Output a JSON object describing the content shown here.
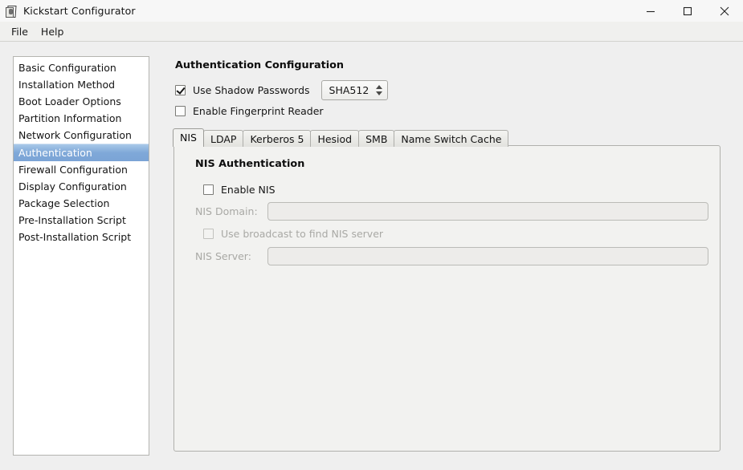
{
  "window": {
    "title": "Kickstart Configurator",
    "icon": "kickstart-app-icon",
    "controls": {
      "minimize": "minimize-icon",
      "maximize": "maximize-icon",
      "close": "close-icon"
    }
  },
  "menubar": {
    "items": [
      {
        "label": "File"
      },
      {
        "label": "Help"
      }
    ]
  },
  "sidebar": {
    "items": [
      {
        "label": "Basic Configuration",
        "selected": false
      },
      {
        "label": "Installation Method",
        "selected": false
      },
      {
        "label": "Boot Loader Options",
        "selected": false
      },
      {
        "label": "Partition Information",
        "selected": false
      },
      {
        "label": "Network Configuration",
        "selected": false
      },
      {
        "label": "Authentication",
        "selected": true
      },
      {
        "label": "Firewall Configuration",
        "selected": false
      },
      {
        "label": "Display Configuration",
        "selected": false
      },
      {
        "label": "Package Selection",
        "selected": false
      },
      {
        "label": "Pre-Installation Script",
        "selected": false
      },
      {
        "label": "Post-Installation Script",
        "selected": false
      }
    ]
  },
  "main": {
    "title": "Authentication Configuration",
    "shadow_passwords": {
      "label": "Use Shadow Passwords",
      "checked": true
    },
    "hash_algorithm": {
      "value": "SHA512"
    },
    "fingerprint_reader": {
      "label": "Enable Fingerprint Reader",
      "checked": false
    },
    "tabs": [
      {
        "label": "NIS",
        "active": true
      },
      {
        "label": "LDAP",
        "active": false
      },
      {
        "label": "Kerberos 5",
        "active": false
      },
      {
        "label": "Hesiod",
        "active": false
      },
      {
        "label": "SMB",
        "active": false
      },
      {
        "label": "Name Switch Cache",
        "active": false
      }
    ],
    "nis_panel": {
      "group_title": "NIS Authentication",
      "enable_nis": {
        "label": "Enable NIS",
        "checked": false,
        "disabled": false
      },
      "nis_domain": {
        "label": "NIS Domain:",
        "value": "",
        "disabled": true
      },
      "use_broadcast": {
        "label": "Use broadcast to find NIS server",
        "checked": false,
        "disabled": true
      },
      "nis_server": {
        "label": "NIS Server:",
        "value": "",
        "disabled": true
      }
    }
  },
  "colors": {
    "selection": "#7fa8d8",
    "window_bg": "#efefef",
    "panel_bg": "#f2f2f0",
    "list_bg": "#ffffff"
  }
}
